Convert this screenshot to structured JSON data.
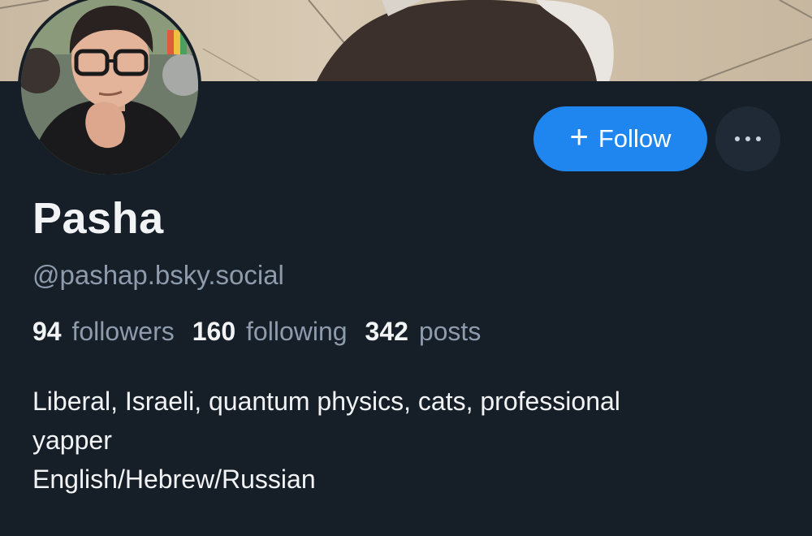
{
  "profile": {
    "display_name": "Pasha",
    "handle": "@pashap.bsky.social",
    "bio_lines": [
      "Liberal, Israeli, quantum physics, cats, professional",
      "yapper",
      "English/Hebrew/Russian"
    ]
  },
  "stats": {
    "followers_count": "94",
    "followers_label": "followers",
    "following_count": "160",
    "following_label": "following",
    "posts_count": "342",
    "posts_label": "posts"
  },
  "actions": {
    "follow_label": "Follow",
    "follow_icon": "plus-icon",
    "more_icon": "ellipsis-icon"
  },
  "colors": {
    "background": "#161e27",
    "accent": "#1f86f0",
    "text_primary": "#f1f3f5",
    "text_secondary": "#8d9bad"
  }
}
